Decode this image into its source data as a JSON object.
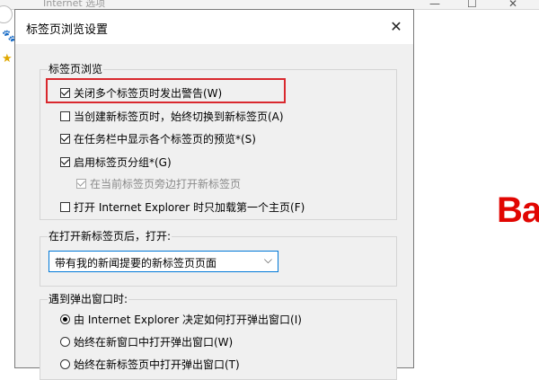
{
  "browser": {
    "title": "Internet 选项",
    "logo_text": "Ba"
  },
  "dialog": {
    "title": "标签页浏览设置",
    "close_glyph": "✕",
    "tab_browsing": {
      "label": "标签页浏览",
      "options": [
        {
          "label": "关闭多个标签页时发出警告(W)",
          "checked": true,
          "enabled": true
        },
        {
          "label": "当创建新标签页时，始终切换到新标签页(A)",
          "checked": false,
          "enabled": true
        },
        {
          "label": "在任务栏中显示各个标签页的预览*(S)",
          "checked": true,
          "enabled": true
        },
        {
          "label": "启用标签页分组*(G)",
          "checked": true,
          "enabled": true
        },
        {
          "label": "在当前标签页旁边打开新标签页",
          "checked": true,
          "enabled": false
        },
        {
          "label": "打开 Internet Explorer 时只加载第一个主页(F)",
          "checked": false,
          "enabled": true
        }
      ]
    },
    "new_tab": {
      "label": "在打开新标签页后，打开:",
      "selected": "带有我的新闻提要的新标签页页面"
    },
    "popup": {
      "label": "遇到弹出窗口时:",
      "options": [
        {
          "label": "由 Internet Explorer 决定如何打开弹出窗口(I)",
          "checked": true
        },
        {
          "label": "始终在新窗口中打开弹出窗口(W)",
          "checked": false
        },
        {
          "label": "始终在新标签页中打开弹出窗口(T)",
          "checked": false
        }
      ]
    }
  },
  "colors": {
    "highlight_border": "#d9282e",
    "logo_red": "#e10602",
    "dropdown_border": "#0078d7"
  }
}
